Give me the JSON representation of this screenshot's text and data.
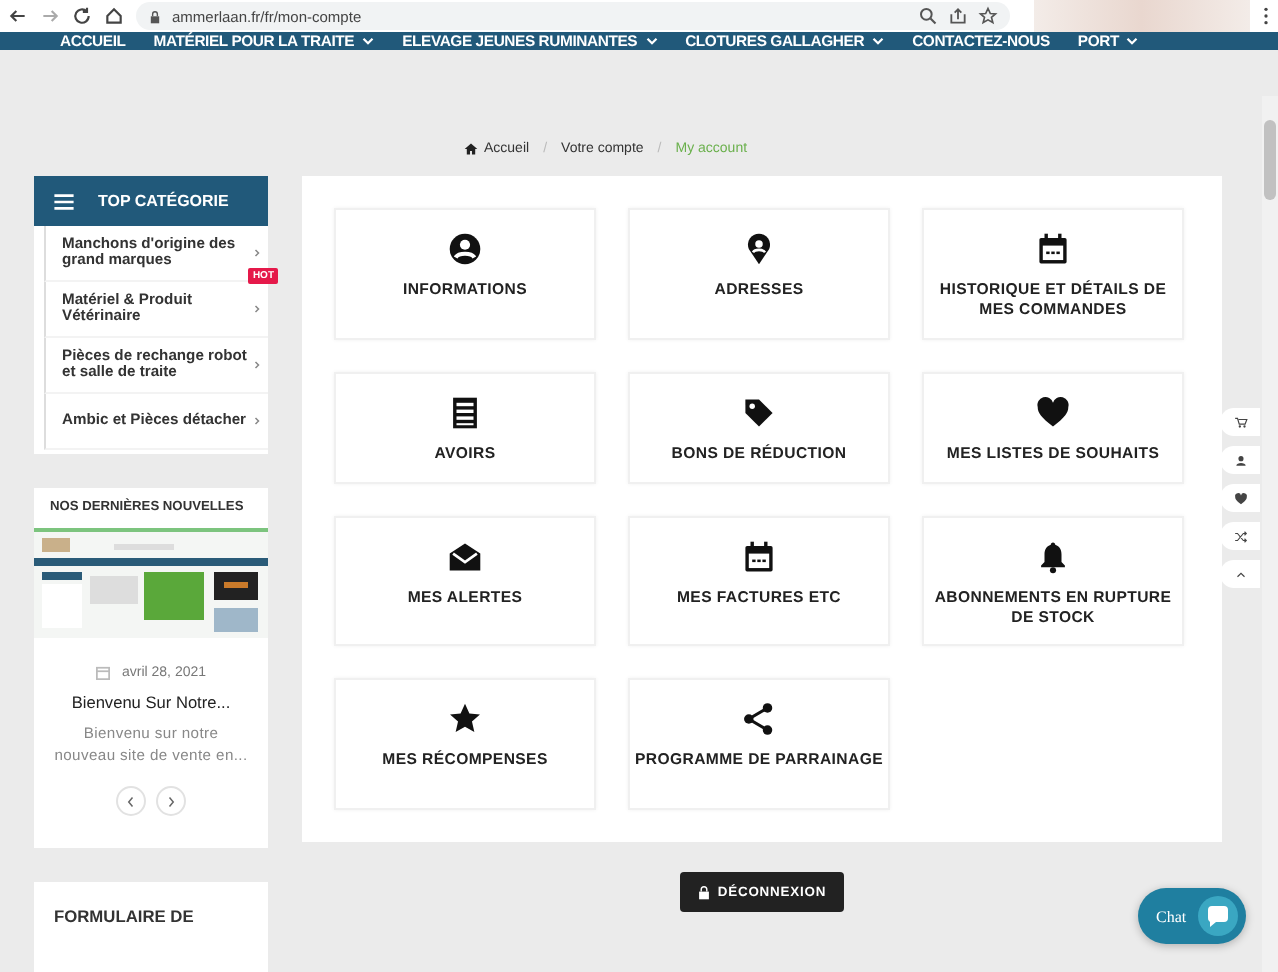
{
  "browser": {
    "url": "ammerlaan.fr/fr/mon-compte"
  },
  "nav": [
    {
      "label": "ACCUEIL",
      "dropdown": false
    },
    {
      "label": "MATÉRIEL POUR LA TRAITE",
      "dropdown": true
    },
    {
      "label": "ELEVAGE JEUNES RUMINANTES",
      "dropdown": true
    },
    {
      "label": "CLOTURES GALLAGHER",
      "dropdown": true
    },
    {
      "label": "CONTACTEZ-NOUS",
      "dropdown": false
    },
    {
      "label": "PORT",
      "dropdown": true
    }
  ],
  "breadcrumb": [
    {
      "label": "Accueil",
      "selected": false
    },
    {
      "separator": "/",
      "label": "Votre compte",
      "selected": false
    },
    {
      "separator": "/",
      "label": "My account",
      "selected": true
    }
  ],
  "sidebar": {
    "title": "TOP CATÉGORIE",
    "items": [
      {
        "label": "Manchons d'origine des grand marques"
      },
      {
        "label": "Matériel & Produit Vétérinaire",
        "badge": "HOT"
      },
      {
        "label": "Pièces de rechange robot et salle de traite"
      },
      {
        "label": "Ambic et Pièces détacher"
      }
    ]
  },
  "news": {
    "title": "NOS DERNIÈRES NOUVELLES",
    "date": "avril 28, 2021",
    "post_title": "Bienvenu Sur Notre...",
    "excerpt": "Bienvenu sur notre nouveau site de vente en..."
  },
  "quick_order": {
    "title": "FORMULAIRE DE"
  },
  "tiles": [
    {
      "label": "INFORMATIONS"
    },
    {
      "label": "ADRESSES"
    },
    {
      "label": "HISTORIQUE ET DÉTAILS DE MES COMMANDES"
    },
    {
      "label": "AVOIRS"
    },
    {
      "label": "BONS DE RÉDUCTION"
    },
    {
      "label": "MES LISTES DE SOUHAITS"
    },
    {
      "label": "MES ALERTES"
    },
    {
      "label": "MES FACTURES ETC"
    },
    {
      "label": "ABONNEMENTS EN RUPTURE DE STOCK"
    },
    {
      "label": "MES RÉCOMPENSES"
    },
    {
      "label": "PROGRAMME DE PARRAINAGE"
    }
  ],
  "logout": {
    "label": "DÉCONNEXION"
  },
  "chat": {
    "label": "Chat"
  }
}
